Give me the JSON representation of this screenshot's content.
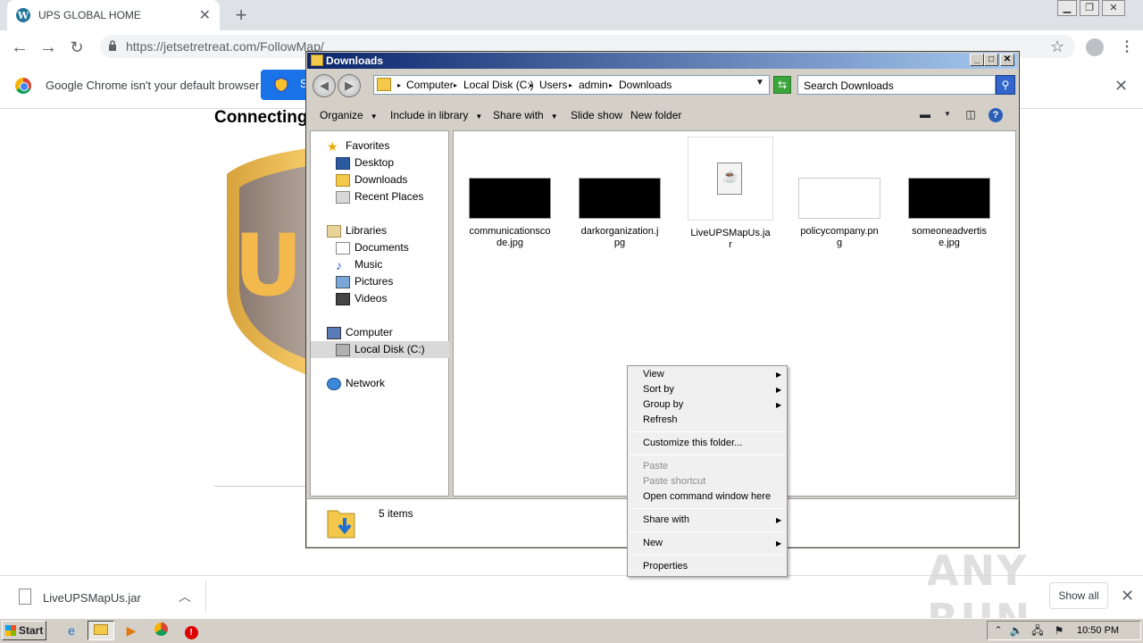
{
  "browser": {
    "tab_title": "UPS GLOBAL HOME",
    "url": "https://jetsetretreat.com/FollowMap/",
    "infobar_text": "Google Chrome isn't your default browser",
    "infobar_button_label": "S",
    "page_heading": "Connecting",
    "download_filename": "LiveUPSMapUs.jar",
    "show_all_label": "Show all"
  },
  "explorer": {
    "title": "Downloads",
    "breadcrumb": [
      "Computer",
      "Local Disk (C:)",
      "Users",
      "admin",
      "Downloads"
    ],
    "search_placeholder": "Search Downloads",
    "commands": {
      "organize": "Organize",
      "include_in_library": "Include in library",
      "share_with": "Share with",
      "slide_show": "Slide show",
      "new_folder": "New folder"
    },
    "nav": {
      "favorites": "Favorites",
      "desktop": "Desktop",
      "downloads": "Downloads",
      "recent_places": "Recent Places",
      "libraries": "Libraries",
      "documents": "Documents",
      "music": "Music",
      "pictures": "Pictures",
      "videos": "Videos",
      "computer": "Computer",
      "local_disk": "Local Disk (C:)",
      "network": "Network"
    },
    "files": [
      {
        "name": "communicationscode.jpg",
        "thumb": "black"
      },
      {
        "name": "darkorganization.jpg",
        "thumb": "black"
      },
      {
        "name": "LiveUPSMapUs.jar",
        "thumb": "jar"
      },
      {
        "name": "policycompany.png",
        "thumb": "white"
      },
      {
        "name": "someoneadvertise.jpg",
        "thumb": "black"
      }
    ],
    "status": "5 items"
  },
  "context_menu": {
    "view": "View",
    "sort_by": "Sort by",
    "group_by": "Group by",
    "refresh": "Refresh",
    "customize": "Customize this folder...",
    "paste": "Paste",
    "paste_shortcut": "Paste shortcut",
    "open_cmd": "Open command window here",
    "share_with": "Share with",
    "new": "New",
    "properties": "Properties"
  },
  "taskbar": {
    "start": "Start",
    "clock": "10:50 PM"
  },
  "watermark": "ANY RUN",
  "colors": {
    "chrome_blue": "#1a73e8",
    "xp_title_start": "#0a246a",
    "xp_title_end": "#a6caf0",
    "taskbar": "#d4d0c8"
  }
}
